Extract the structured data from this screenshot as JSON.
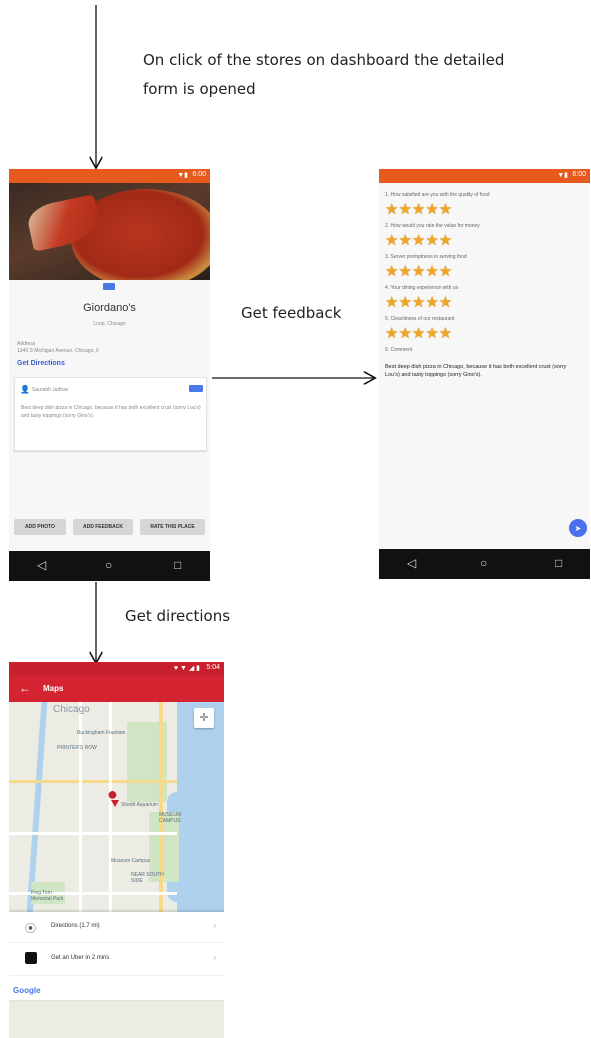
{
  "captions": {
    "dashboard": "On click of the stores on dashboard the detailed\nform is opened",
    "feedback": "Get feedback",
    "directions": "Get directions"
  },
  "store_screen": {
    "status_time": "6:00",
    "name": "Giordano's",
    "location": "Loop, Chicago",
    "address_label": "Address",
    "address": "1340 S Michigan Avenue, Chicago, Il",
    "get_directions": "Get Directions",
    "review_user": "Saurabh Jadhav",
    "review_text": "Best deep dish pizza in Chicago, because it has both excellent crust (sorry Lou's) and tasty toppings (sorry Gino's).",
    "buttons": [
      "ADD PHOTO",
      "ADD FEEDBACK",
      "RATE THIS PLACE"
    ]
  },
  "feedback_screen": {
    "status_time": "6:00",
    "questions": [
      "1. How satisfied are you with the quality of food",
      "2. How would you rate the value for money",
      "3. Server promptness in serving food",
      "4. Your dining experience with us",
      "5. Cleanliness of our restaurant"
    ],
    "comment_label": "6. Comment",
    "comment": "Best deep dish pizza in Chicago, because it has both excellent crust (sorry Lou's) and tasty toppings (sorry Gino's).",
    "stars": "★★★★★"
  },
  "maps_screen": {
    "status_time": "5:04",
    "title": "Maps",
    "labels": [
      "Chicago",
      "Buckingham Fountain",
      "PRINTER'S ROW",
      "Shedd Aquarium",
      "MUSEUM CAMPUS",
      "Museum Campus",
      "NEAR SOUTH SIDE",
      "Ping Tom Memorial Park"
    ],
    "directions": "Directions  (1.7 mi)",
    "uber": "Get an Uber in 2 mins",
    "google": "Google"
  },
  "colors": {
    "store_statusbar": "#e65a1e",
    "maps_appbar": "#d42431",
    "link": "#3a5bd9",
    "star": "#f0a526"
  }
}
